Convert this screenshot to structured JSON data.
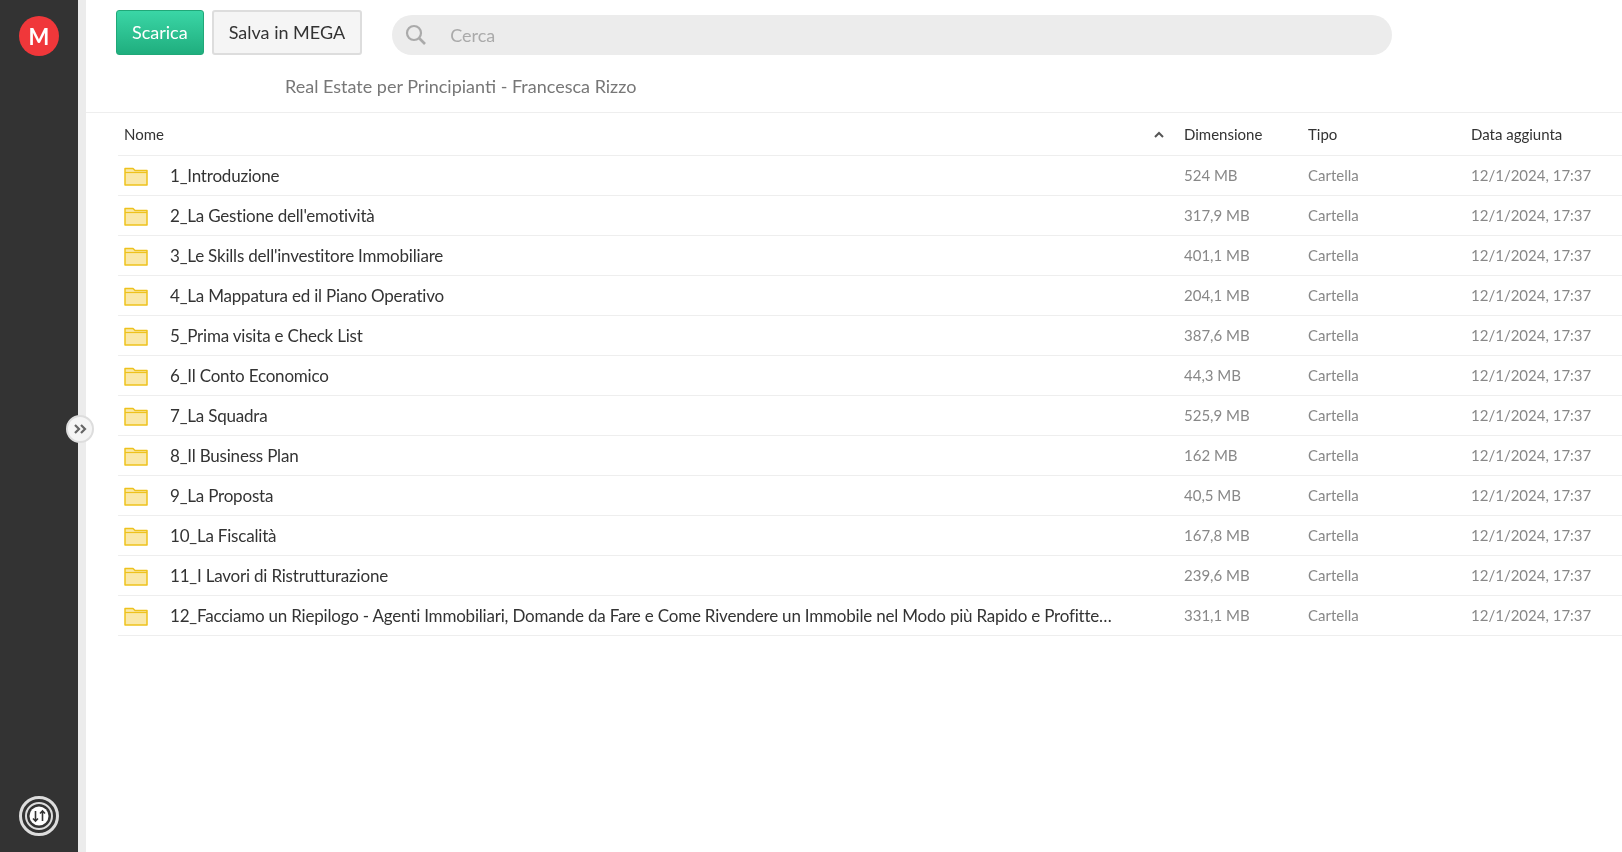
{
  "sidebar": {
    "logo": "M"
  },
  "toolbar": {
    "buttons": [
      {
        "label": "Scarica",
        "kind": "primary"
      },
      {
        "label": "Salva in MEGA",
        "kind": "secondary"
      }
    ],
    "search": {
      "placeholder": "Cerca"
    }
  },
  "folder_title": "Real Estate per Principianti - Francesca Rizzo",
  "table": {
    "columns": [
      {
        "label": "Nome",
        "sorted": true
      },
      {
        "label": "Dimensione",
        "sorted": false
      },
      {
        "label": "Tipo",
        "sorted": false
      },
      {
        "label": "Data aggiunta",
        "sorted": false
      }
    ],
    "rows": [
      {
        "name": "1_Introduzione",
        "size": "524 MB",
        "type": "Cartella",
        "date": "12/1/2024, 17:37"
      },
      {
        "name": "2_La Gestione dell'emotività",
        "size": "317,9 MB",
        "type": "Cartella",
        "date": "12/1/2024, 17:37"
      },
      {
        "name": "3_Le Skills dell'investitore Immobiliare",
        "size": "401,1 MB",
        "type": "Cartella",
        "date": "12/1/2024, 17:37"
      },
      {
        "name": "4_La Mappatura ed il Piano Operativo",
        "size": "204,1 MB",
        "type": "Cartella",
        "date": "12/1/2024, 17:37"
      },
      {
        "name": "5_Prima visita e Check List",
        "size": "387,6 MB",
        "type": "Cartella",
        "date": "12/1/2024, 17:37"
      },
      {
        "name": "6_Il Conto Economico",
        "size": "44,3 MB",
        "type": "Cartella",
        "date": "12/1/2024, 17:37"
      },
      {
        "name": "7_La Squadra",
        "size": "525,9 MB",
        "type": "Cartella",
        "date": "12/1/2024, 17:37"
      },
      {
        "name": "8_Il Business Plan",
        "size": "162 MB",
        "type": "Cartella",
        "date": "12/1/2024, 17:37"
      },
      {
        "name": "9_La Proposta",
        "size": "40,5 MB",
        "type": "Cartella",
        "date": "12/1/2024, 17:37"
      },
      {
        "name": "10_La Fiscalità",
        "size": "167,8 MB",
        "type": "Cartella",
        "date": "12/1/2024, 17:37"
      },
      {
        "name": "11_I Lavori di Ristrutturazione",
        "size": "239,6 MB",
        "type": "Cartella",
        "date": "12/1/2024, 17:37"
      },
      {
        "name": "12_Facciamo un Riepilogo - Agenti Immobiliari, Domande da Fare e Come Rivendere un Immobile nel Modo più Rapido e Profitte…",
        "size": "331,1 MB",
        "type": "Cartella",
        "date": "12/1/2024, 17:37"
      }
    ]
  }
}
